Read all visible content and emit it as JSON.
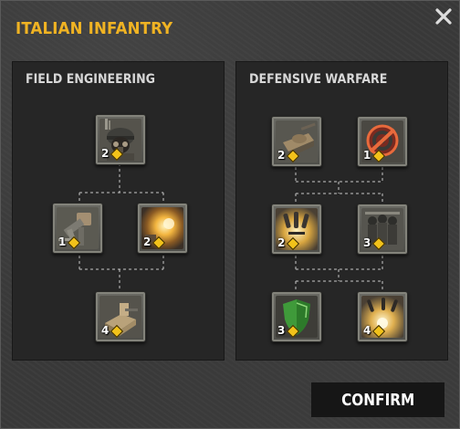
{
  "dialog": {
    "title": "ITALIAN INFANTRY",
    "close_icon": "close-x-icon",
    "confirm_label": "CONFIRM"
  },
  "trees": [
    {
      "title": "FIELD ENGINEERING",
      "abilities": [
        {
          "icon": "helmeted-soldier-icon",
          "cost": "2"
        },
        {
          "icon": "machine-gun-icon",
          "cost": "1"
        },
        {
          "icon": "explosion-icon",
          "cost": "2"
        },
        {
          "icon": "sandbag-emplacement-icon",
          "cost": "4"
        }
      ]
    },
    {
      "title": "DEFENSIVE WARFARE",
      "abilities": [
        {
          "icon": "tank-icon",
          "cost": "2"
        },
        {
          "icon": "no-target-icon",
          "cost": "1"
        },
        {
          "icon": "artillery-shells-icon",
          "cost": "2"
        },
        {
          "icon": "infantry-squad-icon",
          "cost": "3"
        },
        {
          "icon": "green-shield-icon",
          "cost": "3"
        },
        {
          "icon": "barrage-impact-icon",
          "cost": "4"
        }
      ]
    }
  ],
  "colors": {
    "title": "#f0b323",
    "cost_diamond": "#f2c21a",
    "panel": "#262626",
    "background": "#3a3a3a"
  }
}
